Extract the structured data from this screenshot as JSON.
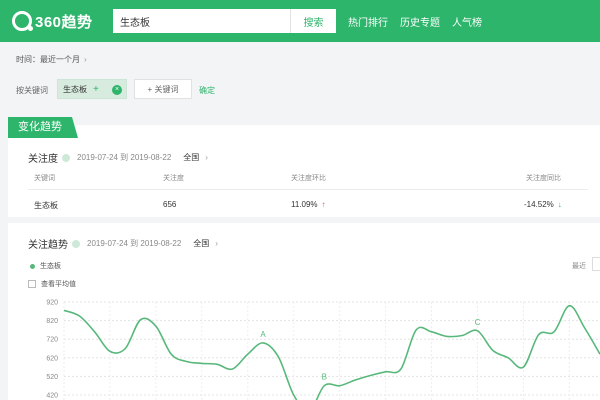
{
  "header": {
    "logo_text": "360趋势",
    "search_value": "生态板",
    "search_button": "搜索",
    "nav": [
      "热门排行",
      "历史专题",
      "人气榜"
    ]
  },
  "filter": {
    "time_label": "时间：最近一个月",
    "keyword_label": "按关键词",
    "keyword_chip": "生态板",
    "chip_plus": "+",
    "chip_clear": "×",
    "add_keyword": "+ 关键词",
    "confirm": "确定"
  },
  "card": {
    "tab": "变化趋势",
    "attention": {
      "title": "关注度",
      "date_range": "2019-07-24 到 2019-08-22",
      "region": "全国",
      "columns": [
        "关键词",
        "关注度",
        "关注度环比",
        "关注度同比"
      ],
      "row": {
        "keyword": "生态板",
        "attention": "656",
        "mom": "11.09%",
        "yoy": "-14.52%"
      }
    },
    "trend": {
      "title": "关注趋势",
      "date_range": "2019-07-24 到 2019-08-22",
      "region": "全国",
      "legend": "生态板",
      "avg_label": "查看平均值",
      "recent_label": "最近",
      "chev": "›"
    }
  },
  "chart_data": {
    "type": "line",
    "title": "",
    "xlabel": "",
    "ylabel": "",
    "ylim": [
      420,
      920
    ],
    "yticks": [
      920,
      820,
      720,
      620,
      520,
      420
    ],
    "grid": true,
    "series": [
      {
        "name": "生态板",
        "color": "#58b87b",
        "values": [
          875,
          845,
          760,
          655,
          670,
          825,
          790,
          640,
          600,
          590,
          585,
          560,
          640,
          700,
          625,
          420,
          330,
          470,
          470,
          500,
          525,
          545,
          560,
          770,
          760,
          735,
          740,
          765,
          660,
          620,
          570,
          745,
          760,
          900,
          780,
          640
        ]
      }
    ],
    "annotations": [
      {
        "label": "A",
        "index": 13
      },
      {
        "label": "B",
        "index": 17
      },
      {
        "label": "C",
        "index": 27
      }
    ]
  },
  "colors": {
    "brand": "#2eb56c",
    "line": "#58b87b",
    "up": "#e8453c",
    "down": "#2eb56c"
  }
}
